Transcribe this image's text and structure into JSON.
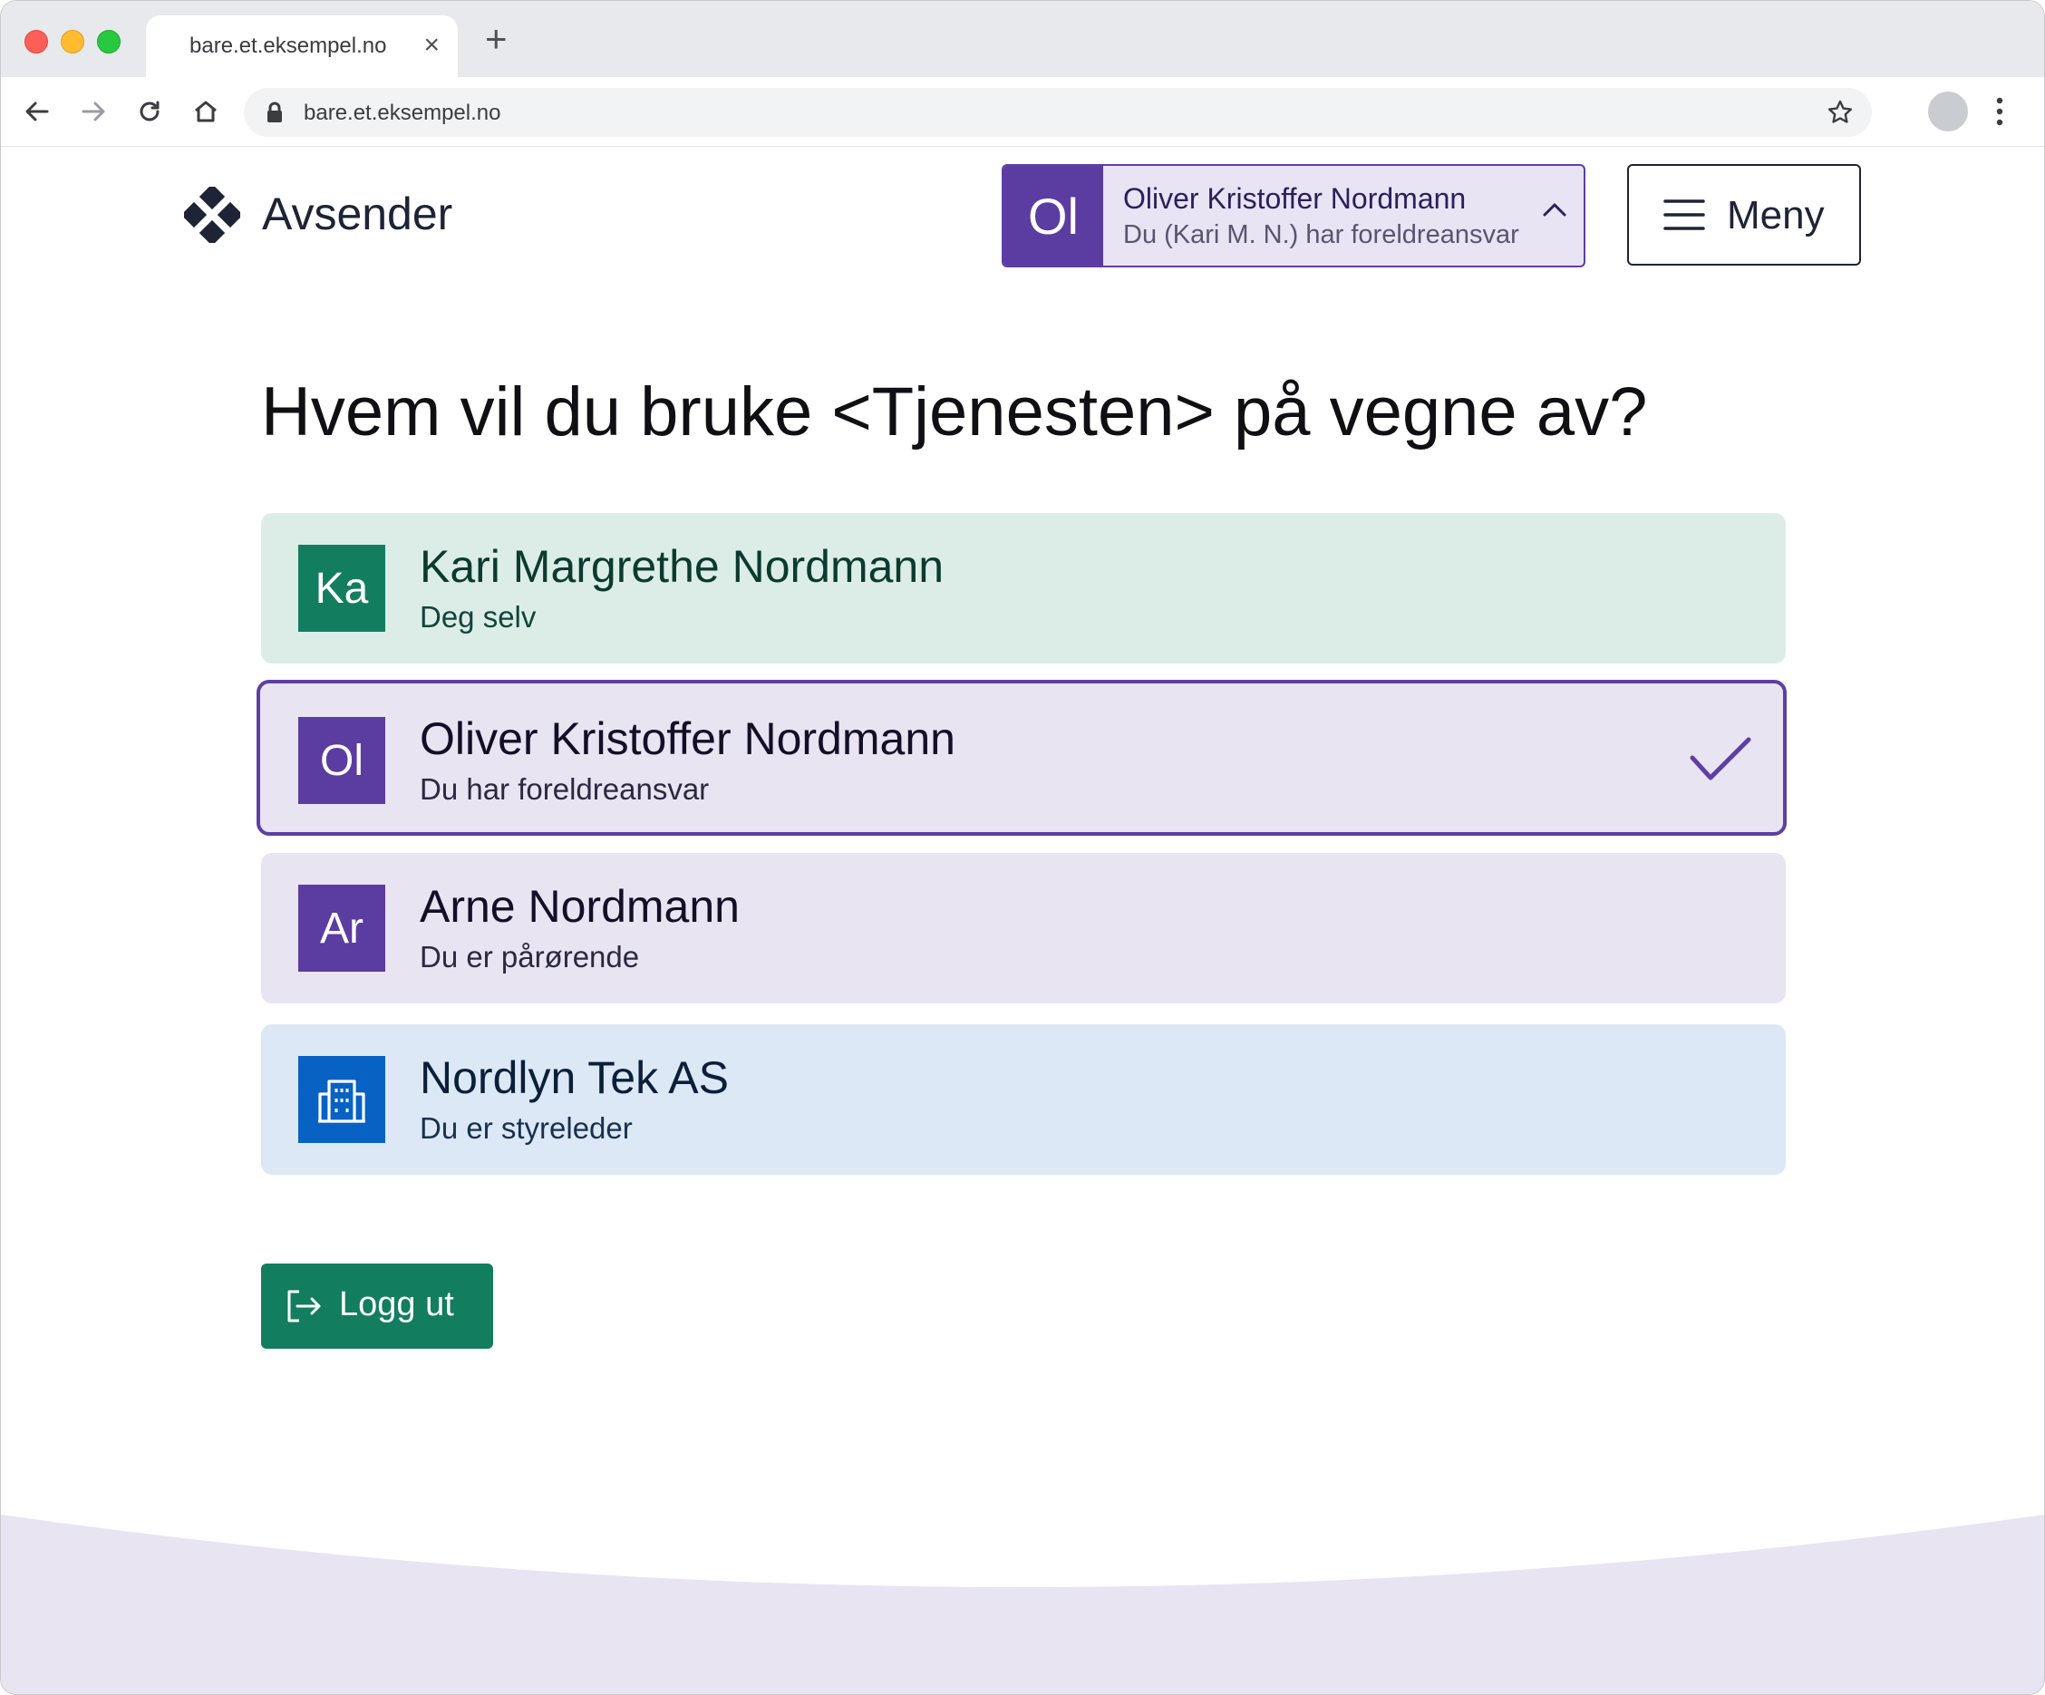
{
  "browser": {
    "tab_title": "bare.et.eksempel.no",
    "tab_close": "×",
    "new_tab": "+",
    "url": "bare.et.eksempel.no"
  },
  "header": {
    "brand": "Avsender",
    "account": {
      "initials": "Ol",
      "name": "Oliver Kristoffer Nordmann",
      "subtitle": "Du (Kari M. N.) har foreldreansvar",
      "color": "#5b3ca1"
    },
    "menu_label": "Meny"
  },
  "main": {
    "heading": "Hvem vil du bruke <Tjenesten> på vegne av?",
    "options": [
      {
        "initials": "Ka",
        "name": "Kari Margrethe Nordmann",
        "subtitle": "Deg selv",
        "color": "#127e5f",
        "background": "#dcede8",
        "selected": false
      },
      {
        "initials": "Ol",
        "name": "Oliver Kristoffer Nordmann",
        "subtitle": "Du har foreldreansvar",
        "color": "#5b3ca1",
        "background": "#e8e4f2",
        "selected": true
      },
      {
        "initials": "Ar",
        "name": "Arne Nordmann",
        "subtitle": "Du er pårørende",
        "color": "#5b3ca1",
        "background": "#e8e4f2",
        "selected": false
      },
      {
        "icon": "building-icon",
        "name": "Nordlyn Tek AS",
        "subtitle": "Du er styreleder",
        "color": "#0862c4",
        "background": "#dce8f5",
        "selected": false
      }
    ],
    "logout_label": "Logg ut"
  }
}
